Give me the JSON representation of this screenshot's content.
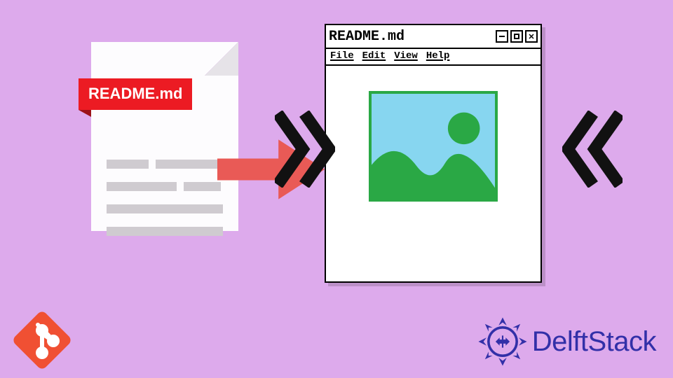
{
  "doc": {
    "label": "README.md"
  },
  "window": {
    "title": "README.md",
    "menu": [
      "File",
      "Edit",
      "View",
      "Help"
    ]
  },
  "brand": {
    "name": "DelftStack"
  },
  "icons": {
    "git_color": "#f05033",
    "delft_emblem_color": "#3230a8",
    "img_bg": "#87d6f0",
    "img_fg": "#2aa845"
  }
}
